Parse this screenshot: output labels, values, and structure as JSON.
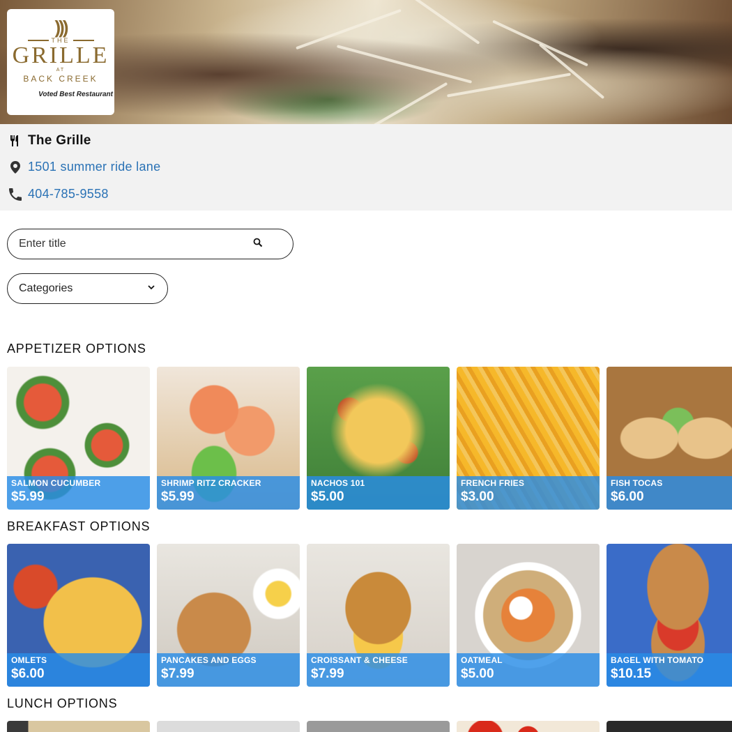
{
  "restaurant": {
    "logo": {
      "the": "THE",
      "name": "GRILLE",
      "at": "AT",
      "location": "BACK CREEK",
      "tagline": "Voted Best Restaurant"
    },
    "name": "The Grille",
    "address": "1501 summer ride lane",
    "phone": "404-785-9558"
  },
  "search": {
    "placeholder": "Enter title"
  },
  "categories": {
    "selected": "Categories"
  },
  "sections": [
    {
      "title": "APPETIZER OPTIONS",
      "items": [
        {
          "title": "SALMON CUCUMBER",
          "price": "$5.99"
        },
        {
          "title": "SHRIMP RITZ CRACKER",
          "price": "$5.99"
        },
        {
          "title": "NACHOS 101",
          "price": "$5.00"
        },
        {
          "title": "FRENCH FRIES",
          "price": "$3.00"
        },
        {
          "title": "FISH TOCAS",
          "price": "$6.00"
        }
      ]
    },
    {
      "title": "BREAKFAST OPTIONS",
      "items": [
        {
          "title": "OMLETS",
          "price": "$6.00"
        },
        {
          "title": "PANCAKES AND EGGS",
          "price": "$7.99"
        },
        {
          "title": "CROISSANT & CHEESE",
          "price": "$7.99"
        },
        {
          "title": "OATMEAL",
          "price": "$5.00"
        },
        {
          "title": "BAGEL WITH TOMATO",
          "price": "$10.15"
        }
      ]
    },
    {
      "title": "LUNCH OPTIONS",
      "items": []
    }
  ],
  "colors": {
    "accent_link": "#2a72b5",
    "card_overlay": "#288ce6",
    "logo_gold": "#8a6a2f"
  },
  "icons": [
    "utensils-icon",
    "map-pin-icon",
    "phone-icon",
    "search-icon",
    "chevron-down-icon"
  ]
}
